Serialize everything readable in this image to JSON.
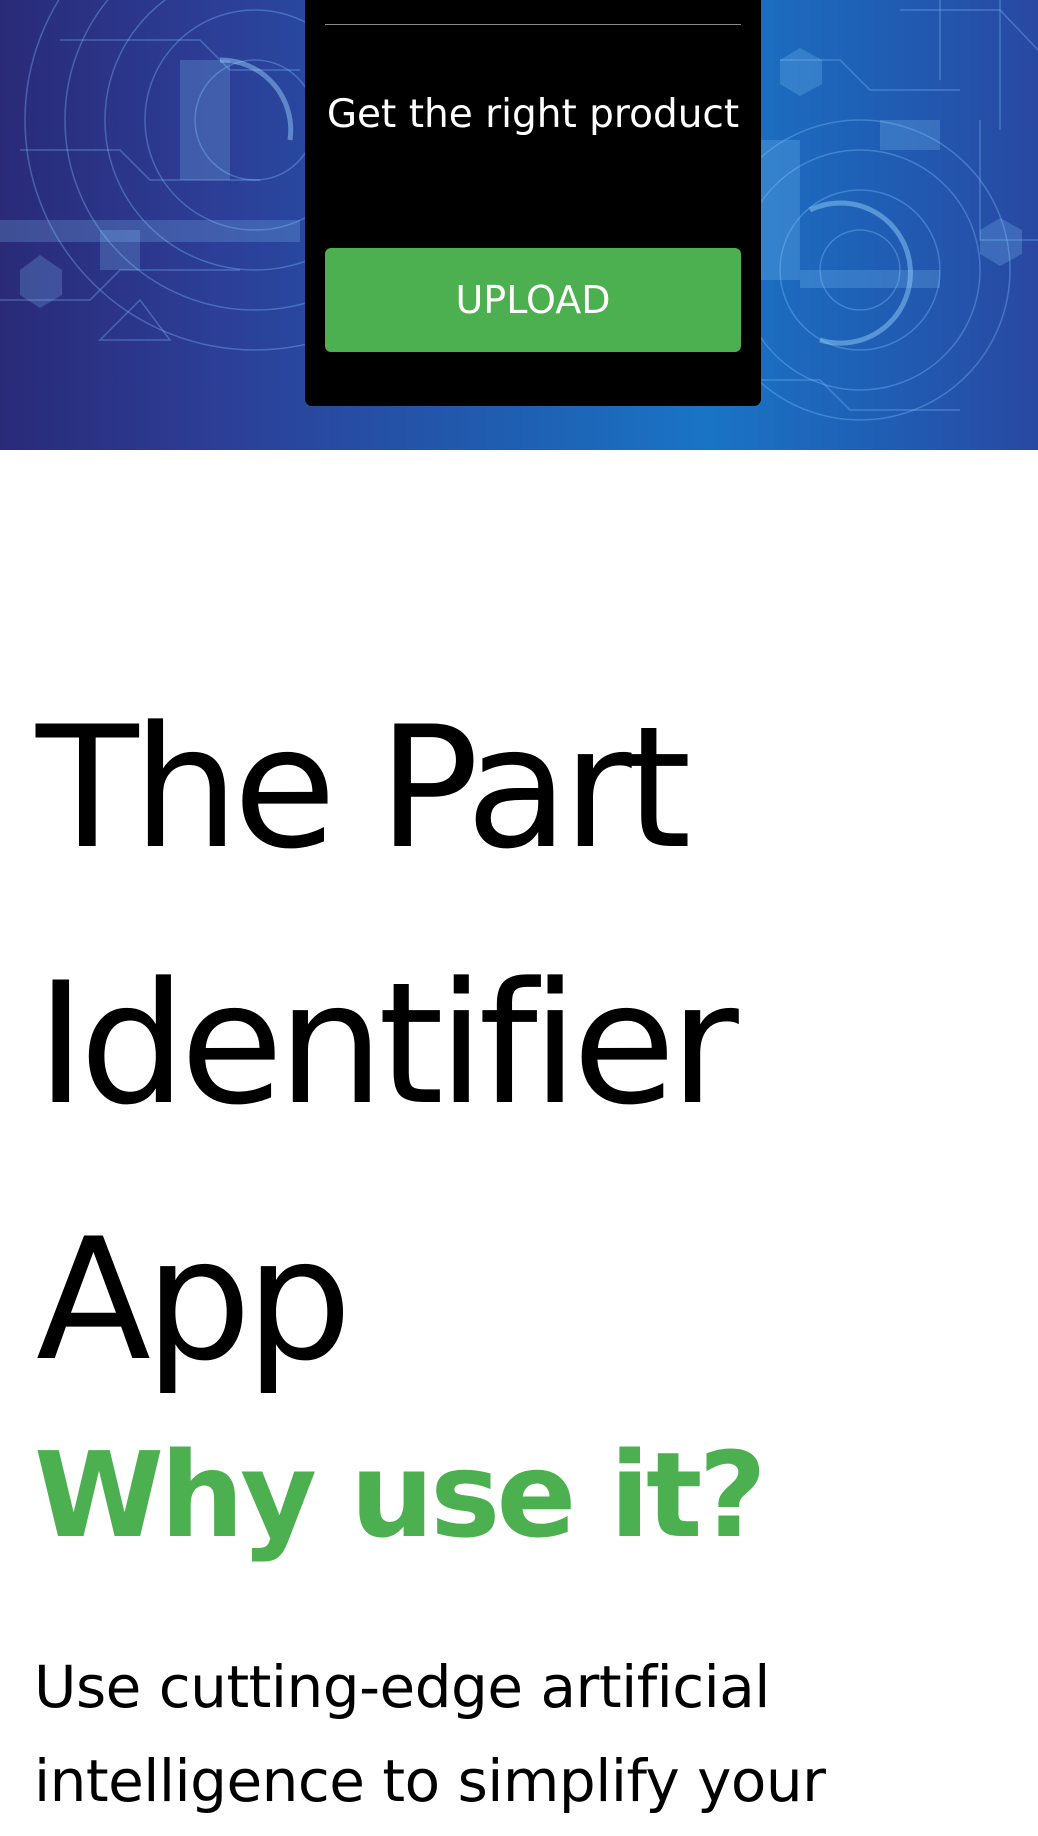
{
  "hero": {
    "card": {
      "tagline": "Get the right product",
      "upload_label": "UPLOAD"
    },
    "colors": {
      "card_background": "#000000",
      "button_green": "#4caf50",
      "circuit_blue": "#1a74c6"
    }
  },
  "main": {
    "title": "The Part Identifier App",
    "subtitle": "Why use it?",
    "body": "Use cutting-edge artificial intelligence to simplify your"
  }
}
